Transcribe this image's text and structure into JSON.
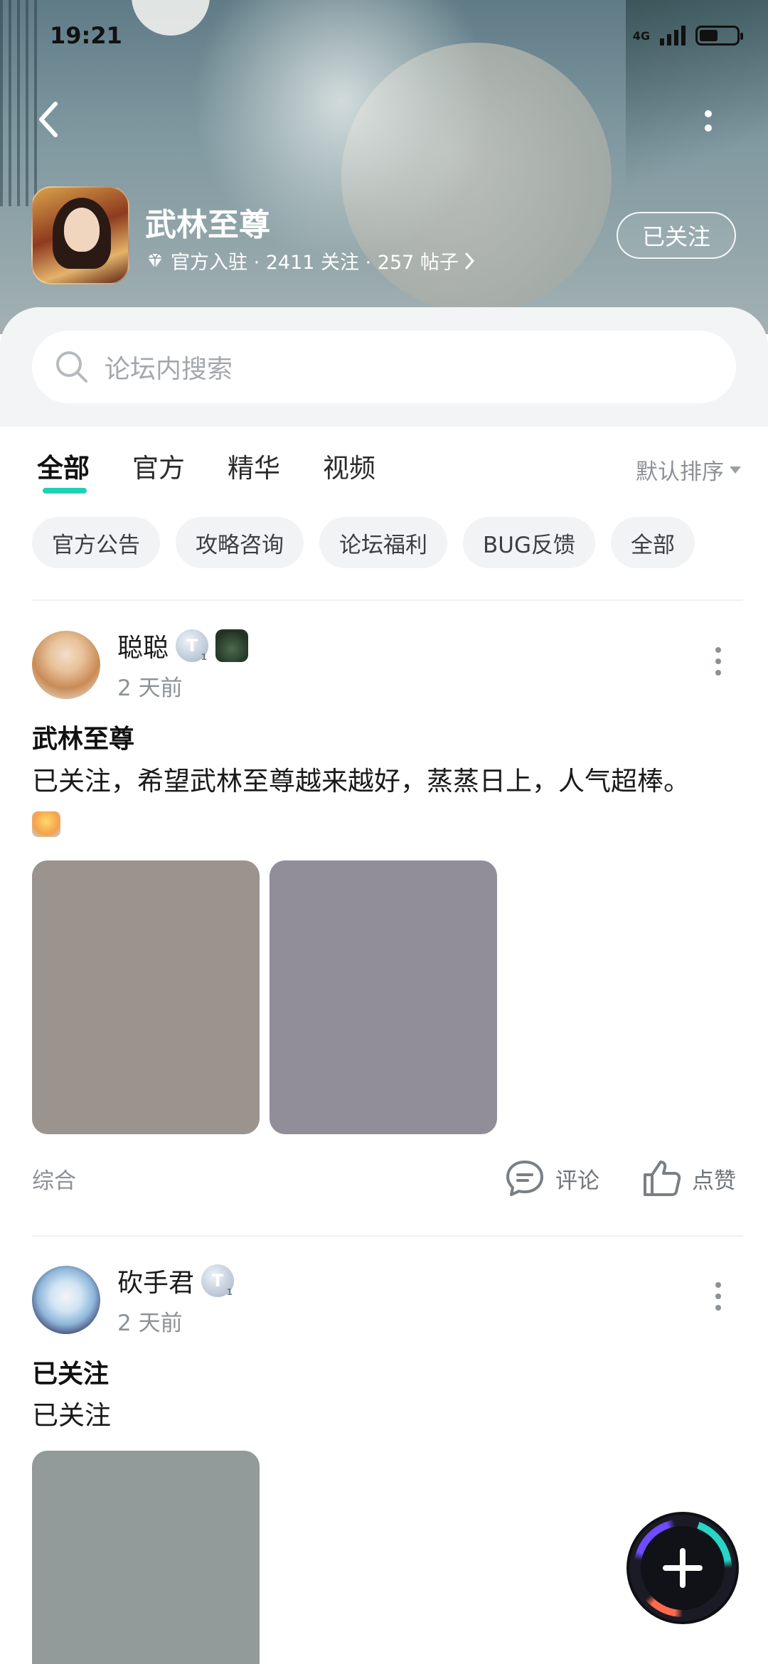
{
  "status_bar": {
    "time": "19:21",
    "network": "4G"
  },
  "header": {
    "forum_name": "武林至尊",
    "meta_text": "官方入驻 · 2411 关注 · 257 帖子",
    "follow_label": "已关注"
  },
  "search": {
    "placeholder": "论坛内搜索"
  },
  "tabs": [
    {
      "label": "全部",
      "active": true
    },
    {
      "label": "官方",
      "active": false
    },
    {
      "label": "精华",
      "active": false
    },
    {
      "label": "视频",
      "active": false
    }
  ],
  "sort_label": "默认排序",
  "chips": [
    "官方公告",
    "攻略咨询",
    "论坛福利",
    "BUG反馈",
    "全部"
  ],
  "posts": [
    {
      "username": "聪聪",
      "badge": "T",
      "time": "2 天前",
      "title": "武林至尊",
      "body": "已关注，希望武林至尊越来越好，蒸蒸日上，人气超棒。",
      "image_colors": [
        "#9b938e",
        "#918d99"
      ],
      "category": "综合",
      "comment_label": "评论",
      "like_label": "点赞"
    },
    {
      "username": "砍手君",
      "badge": "T",
      "time": "2 天前",
      "title": "已关注",
      "body": "已关注",
      "image_colors": [
        "#939a9a"
      ]
    }
  ],
  "colors": {
    "accent": "#1fd1b8",
    "chip_bg": "#f2f3f5"
  }
}
